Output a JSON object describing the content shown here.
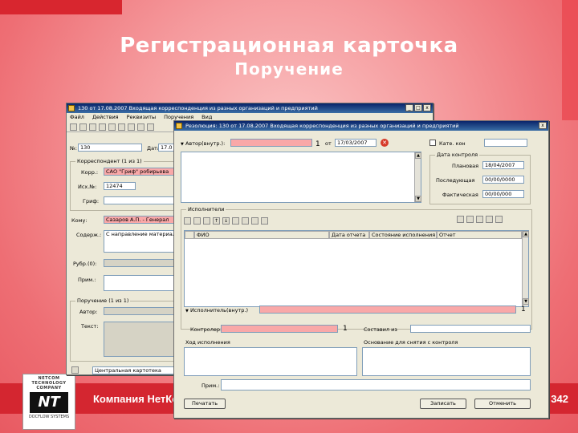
{
  "slide": {
    "title": "Регистрационная карточка",
    "subtitle": "Поручение",
    "footer_text": "Компания НетКо",
    "page_number": "342",
    "logo": {
      "top": "NETCOM TECHNOLOGY COMPANY",
      "mark": "NT",
      "bottom": "DOCFLOW SYSTEMS"
    }
  },
  "back_window": {
    "title": "130 от 17.08.2007 Входящая корреспонденция из разных организаций и предприятий",
    "menu": [
      "Файл",
      "Действия",
      "Реквизиты",
      "Поручения",
      "Вид"
    ],
    "labels": {
      "num": "№:",
      "from_group": "Корреспондент (1 из 1)",
      "korr": "Корр.:",
      "out_num": "Исх.№:",
      "grif": "Гриф:",
      "komu": "Кому:",
      "sod": "Содерж.:",
      "rubr": "Рубр.(0):",
      "prim": "Прим.:",
      "poruch_group": "Поручение (1 из 1)",
      "avtor": "Автор:",
      "text": "Текст:",
      "dat": "Дата:"
    },
    "values": {
      "num": "130",
      "date_short": "17.0",
      "korr": "САО \"Гриф\" робирьева",
      "out_num": "12474",
      "komu": "Сазаров А.П. - Генерал",
      "sod": "С направление материала",
      "status": "Центральная картотека"
    }
  },
  "front_window": {
    "title": "Резолюция: 130 от 17.08.2007 Входящая корреспонденция из разных организаций и предприятий",
    "labels": {
      "avtor": "Автор(внутр.):",
      "ot": "от",
      "zam": "Кате. кон",
      "control_group": "Дата контроля",
      "plan": "Плановая",
      "povtor": "Последующая",
      "fact": "Фактическая",
      "ispolnit_group": "Исполнители",
      "ispolnit_vnesh": "Исполнитель(внутр.)",
      "kontrol": "Контролер:",
      "sostav": "Составил из",
      "hod": "Ход исполнения",
      "osnov": "Основание для снятия с контроля",
      "prim": "Прим.:",
      "print_btn": "Печатать",
      "save_btn": "Записать",
      "cancel_btn": "Отменить"
    },
    "values": {
      "ot_date": "17/03/2007",
      "plan": "18/04/2007",
      "povtor": "00/00/0000",
      "fact": "00/00/000",
      "count_1": "1",
      "count_2": "1",
      "count_3": "1"
    },
    "table_headers": [
      "ФИО",
      "Дата отчета",
      "Состояние исполнения",
      "Отчет"
    ]
  }
}
